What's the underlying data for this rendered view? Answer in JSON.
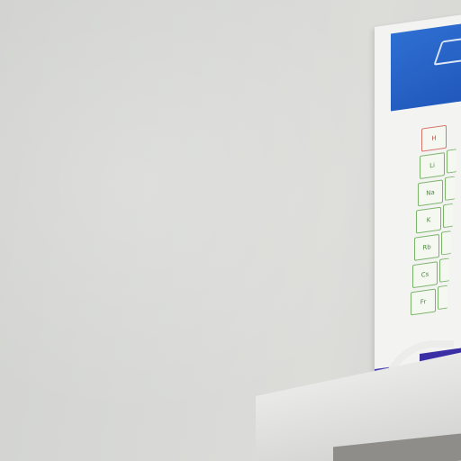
{
  "image": {
    "description_elements": {
      "poster": {
        "header_color": "#2f6fd2",
        "table_accent_color": "#7cb46a",
        "band_color": "#3b2fa6"
      },
      "symbols": [
        "H",
        "Li",
        "Na",
        "K",
        "Rb",
        "Cs",
        "Fr"
      ]
    }
  }
}
